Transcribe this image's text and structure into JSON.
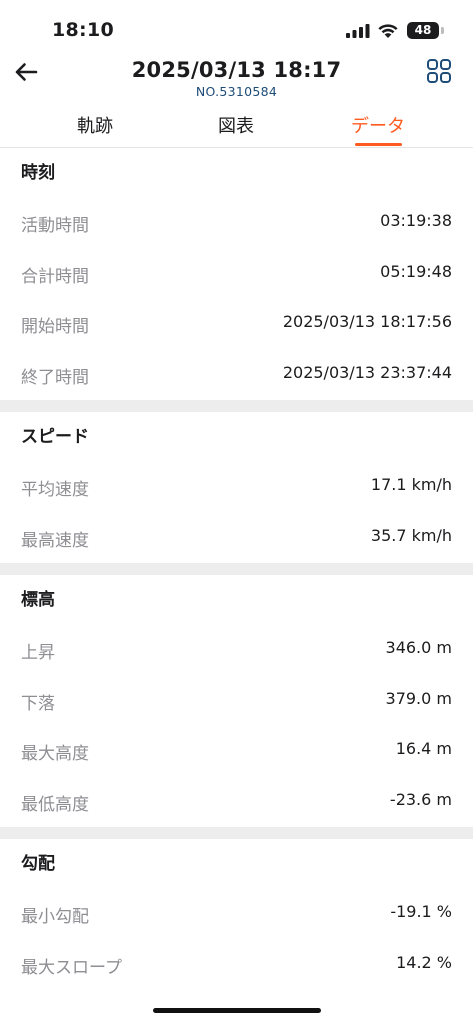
{
  "status": {
    "time": "18:10",
    "battery": "48"
  },
  "header": {
    "title": "2025/03/13 18:17",
    "subtitle": "NO.5310584"
  },
  "tabs": [
    {
      "label": "軌跡"
    },
    {
      "label": "図表"
    },
    {
      "label": "データ"
    }
  ],
  "sections": [
    {
      "title": "時刻",
      "rows": [
        {
          "label": "活動時間",
          "value": "03:19:38"
        },
        {
          "label": "合計時間",
          "value": "05:19:48"
        },
        {
          "label": "開始時間",
          "value": "2025/03/13 18:17:56"
        },
        {
          "label": "終了時間",
          "value": "2025/03/13 23:37:44"
        }
      ]
    },
    {
      "title": "スピード",
      "rows": [
        {
          "label": "平均速度",
          "value": "17.1 km/h"
        },
        {
          "label": "最高速度",
          "value": "35.7 km/h"
        }
      ]
    },
    {
      "title": "標高",
      "rows": [
        {
          "label": "上昇",
          "value": "346.0 m"
        },
        {
          "label": "下落",
          "value": "379.0 m"
        },
        {
          "label": "最大高度",
          "value": "16.4 m"
        },
        {
          "label": "最低高度",
          "value": "-23.6 m"
        }
      ]
    },
    {
      "title": "勾配",
      "rows": [
        {
          "label": "最小勾配",
          "value": "-19.1 %"
        },
        {
          "label": "最大スロープ",
          "value": "14.2 %"
        }
      ]
    }
  ]
}
